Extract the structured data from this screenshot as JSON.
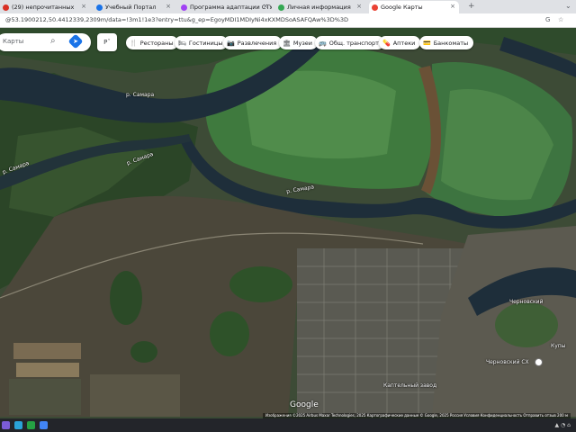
{
  "browser": {
    "tabs": [
      {
        "label": "(29) непрочитанных",
        "color": "#d93025"
      },
      {
        "label": "Учебный Портал",
        "color": "#1a73e8"
      },
      {
        "label": "Программа адаптации СТУ",
        "color": "#a142f4"
      },
      {
        "label": "Личная информация",
        "color": "#34a853"
      },
      {
        "label": "Google Карты",
        "color": "#ea4335",
        "active": true
      }
    ],
    "new_tab_symbol": "+",
    "close_symbol": "×",
    "url": "@53.1900212,50.4412339,2309m/data=!3m1!1e3?entry=ttu&g_ep=EgoyMDI1MDIyNi4xKXMDSoASAFQAw%3D%3D"
  },
  "maps": {
    "search_placeholder": "Карты",
    "route_label": "Р",
    "chips": [
      {
        "icon": "restaurant-icon",
        "glyph": "🍴",
        "label": "Рестораны"
      },
      {
        "icon": "hotel-icon",
        "glyph": "🛏",
        "label": "Гостиницы"
      },
      {
        "icon": "camera-icon",
        "glyph": "📷",
        "label": "Развлечения"
      },
      {
        "icon": "museum-icon",
        "glyph": "🏛",
        "label": "Музеи"
      },
      {
        "icon": "bus-icon",
        "glyph": "🚌",
        "label": "Общ. транспорт"
      },
      {
        "icon": "pharmacy-icon",
        "glyph": "💊",
        "label": "Аптеки"
      },
      {
        "icon": "atm-icon",
        "glyph": "💳",
        "label": "Банкоматы"
      }
    ],
    "labels": {
      "river1": "р. Самара",
      "river2": "р. Самара",
      "river3": "р. Самара",
      "river4": "р. Самара",
      "place1": "Черновский",
      "place2": "Черновский СХ",
      "place3": "Купы",
      "street": "Каптельный завод"
    },
    "google": "Google",
    "attribution": "Изображения ©2025 Airbus Maxar Technologies, 2025 Картографические данные © Google, 2025   Россия   Условия   Конфиденциальность   Отправить отзыв   200 м"
  },
  "colors": {
    "river": "#1e2e3a",
    "field": "#3f7a3e",
    "fieldLight": "#5e9a55",
    "forest": "#2d4a2a",
    "earth": "#4b473a"
  }
}
